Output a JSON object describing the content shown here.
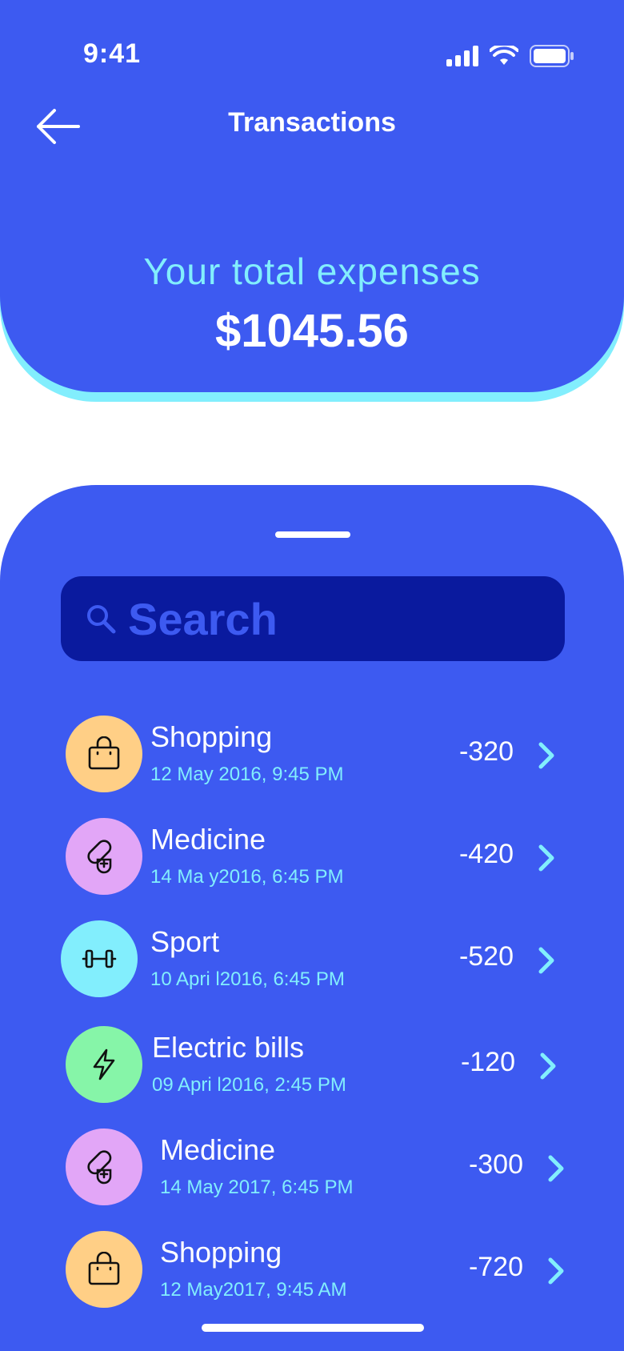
{
  "status_bar": {
    "time": "9:41"
  },
  "header": {
    "title": "Transactions",
    "expenses_label": "Your total expenses",
    "expenses_amount": "$1045.56"
  },
  "search": {
    "placeholder": "Search"
  },
  "transactions": [
    {
      "name": "Shopping",
      "date": "12 May 2016, 9:45 PM",
      "amount": "-320",
      "icon": "shopping-bag-icon",
      "color": "#FFCF86"
    },
    {
      "name": "Medicine",
      "date": "14 Ma y2016, 6:45 PM",
      "amount": "-420",
      "icon": "medicine-icon",
      "color": "#E2A6F7"
    },
    {
      "name": "Sport",
      "date": "10 Apri l2016, 6:45 PM",
      "amount": "-520",
      "icon": "dumbbell-icon",
      "color": "#82EEFD"
    },
    {
      "name": "Electric bills",
      "date": "09 Apri l2016, 2:45 PM",
      "amount": "-120",
      "icon": "lightning-icon",
      "color": "#86F5A8"
    },
    {
      "name": "Medicine",
      "date": "14 May 2017, 6:45 PM",
      "amount": "-300",
      "icon": "medicine-icon",
      "color": "#E2A6F7"
    },
    {
      "name": "Shopping",
      "date": "12 May2017, 9:45 AM",
      "amount": "-720",
      "icon": "shopping-bag-icon",
      "color": "#FFCF86"
    }
  ],
  "colors": {
    "primary": "#3D5AF1",
    "accent": "#82EEFD",
    "search_bg": "#0A1A9E"
  }
}
